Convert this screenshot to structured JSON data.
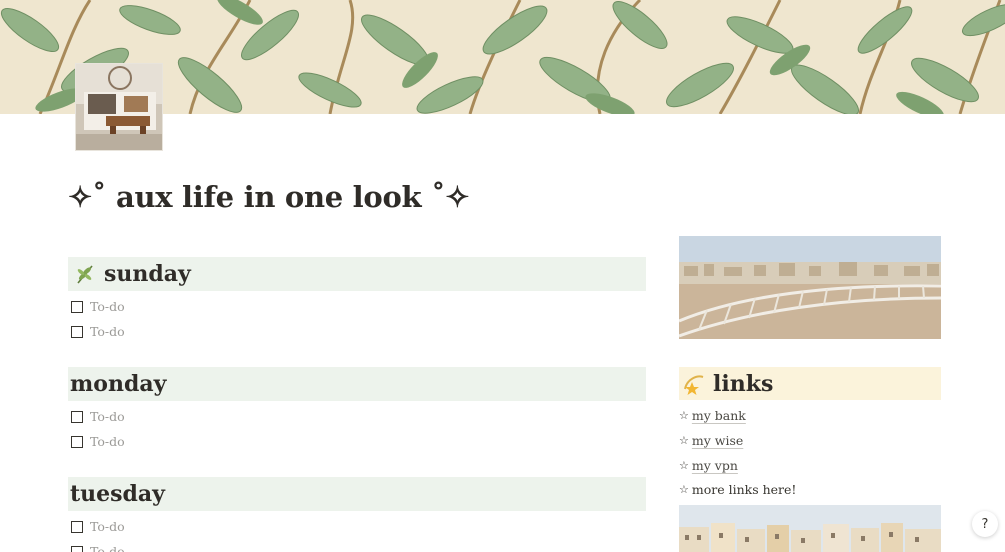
{
  "cover": {
    "icon": "leaf-pattern-cover"
  },
  "page_icon": {
    "icon": "bedroom-photo"
  },
  "title": "✧˚ aux life in one look ˚✧",
  "days": [
    {
      "label": "sunday",
      "emoji": "herb-icon",
      "todos": [
        "To-do",
        "To-do"
      ]
    },
    {
      "label": "monday",
      "emoji": "",
      "todos": [
        "To-do",
        "To-do"
      ]
    },
    {
      "label": "tuesday",
      "emoji": "",
      "todos": [
        "To-do",
        "To-do"
      ]
    }
  ],
  "links": {
    "heading": "links",
    "emoji": "shooting-star-icon",
    "items": [
      {
        "star": "☆",
        "label": "my bank",
        "is_link": true
      },
      {
        "star": "☆",
        "label": "my wise",
        "is_link": true
      },
      {
        "star": "☆",
        "label": "my vpn",
        "is_link": true
      },
      {
        "star": "☆",
        "label": "more links here!",
        "is_link": false
      }
    ]
  },
  "photos": [
    "city-rooftop-photo",
    "waterfront-buildings-photo"
  ],
  "help": {
    "label": "?"
  },
  "colors": {
    "day_heading_bg": "#edf3ec",
    "links_heading_bg": "#fbf3db",
    "cover_bg": "#efe6cf",
    "leaf_green": "#8fae7e"
  }
}
